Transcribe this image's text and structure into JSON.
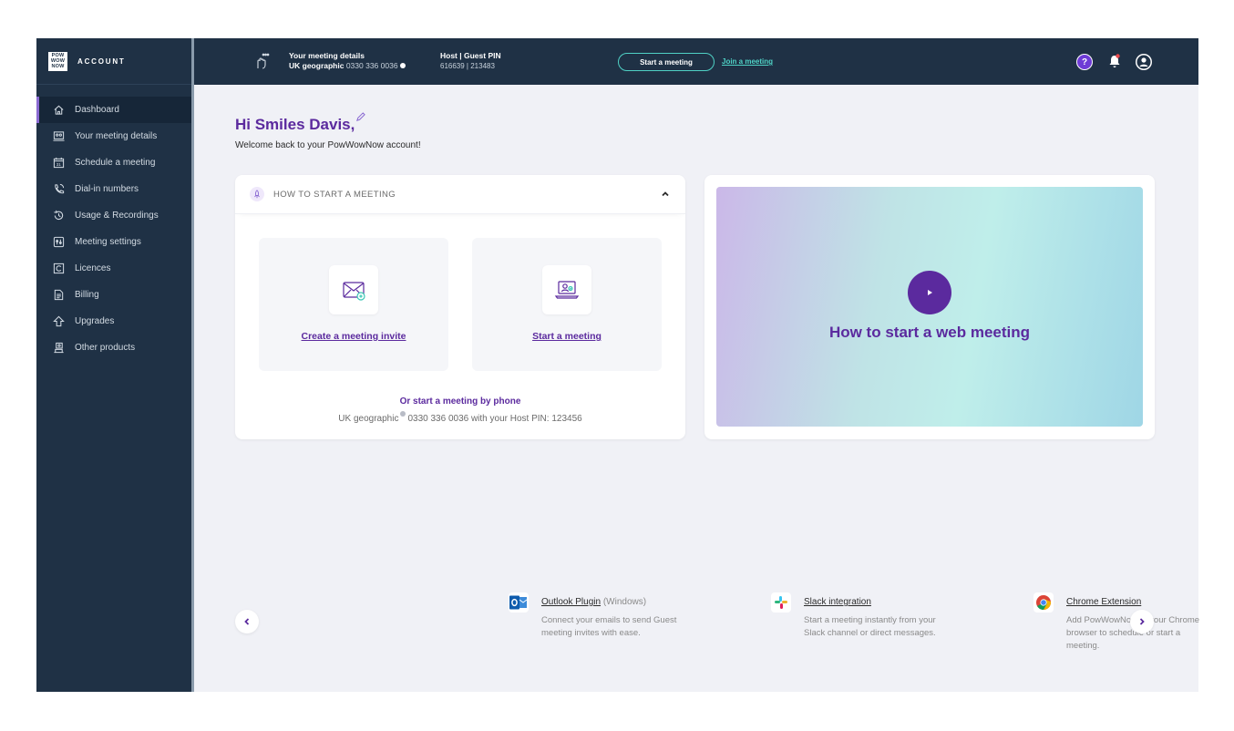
{
  "brand": {
    "logo_text": "POW WOW NOW",
    "label": "ACCOUNT"
  },
  "sidebar": {
    "items": [
      {
        "label": "Dashboard",
        "icon": "home-icon"
      },
      {
        "label": "Your meeting details",
        "icon": "meeting-details-icon"
      },
      {
        "label": "Schedule a meeting",
        "icon": "calendar-icon"
      },
      {
        "label": "Dial-in numbers",
        "icon": "phone-icon"
      },
      {
        "label": "Usage & Recordings",
        "icon": "history-icon"
      },
      {
        "label": "Meeting settings",
        "icon": "settings-icon"
      },
      {
        "label": "Licences",
        "icon": "licence-icon"
      },
      {
        "label": "Billing",
        "icon": "document-icon"
      },
      {
        "label": "Upgrades",
        "icon": "upgrade-icon"
      },
      {
        "label": "Other products",
        "icon": "products-icon"
      }
    ]
  },
  "topbar": {
    "details_title": "Your meeting details",
    "details_region": "UK geographic",
    "details_number": "0330 336 0036",
    "pin_title": "Host | Guest PIN",
    "pin_values": "616639 | 213483",
    "start_label": "Start a meeting",
    "join_label": "Join a meeting",
    "help_label": "?"
  },
  "main": {
    "greeting": "Hi Smiles Davis,",
    "welcome": "Welcome back to your PowWowNow account!",
    "how_to": {
      "header": "HOW TO START A MEETING",
      "tile_invite": "Create a meeting invite",
      "tile_start": "Start a meeting",
      "phone_title": "Or start a meeting by phone",
      "phone_region": "UK geographic",
      "phone_text": "0330 336 0036 with your Host PIN: 123456"
    },
    "video": {
      "title": "How to start a web meeting"
    }
  },
  "integrations": [
    {
      "title": "Outlook Plugin",
      "suffix": "(Windows)",
      "desc": "Connect your emails to send Guest meeting invites with ease.",
      "icon": "outlook-icon"
    },
    {
      "title": "Slack integration",
      "suffix": "",
      "desc": "Start a meeting instantly from your Slack channel or direct messages.",
      "icon": "slack-icon"
    },
    {
      "title": "Chrome Extension",
      "suffix": "",
      "desc": "Add PowWowNow to your Chrome browser to schedule or start a meeting.",
      "icon": "chrome-icon"
    }
  ],
  "colors": {
    "sidebar_bg": "#1f3145",
    "accent_purple": "#5b2a9e",
    "accent_teal": "#4fd1c5",
    "page_bg": "#f0f1f6"
  }
}
